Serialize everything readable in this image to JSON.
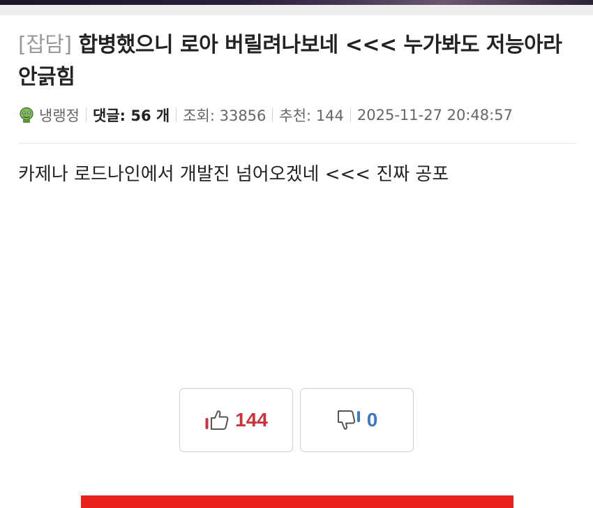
{
  "post": {
    "category": "[잡담]",
    "title": "합병했으니 로아 버릴려나보네 <<< 누가봐도 저능아라 안긁힘",
    "body": "카제나 로드나인에서 개발진 넘어오겠네 <<< 진짜 공포"
  },
  "meta": {
    "author": "냉랭정",
    "comments_label": "댓글:",
    "comments_count": "56 개",
    "views_label": "조회:",
    "views": "33856",
    "recommend_label": "추천:",
    "recommend": "144",
    "datetime": "2025-11-27 20:48:57"
  },
  "votes": {
    "up_count": "144",
    "down_count": "0"
  },
  "colors": {
    "upvote": "#c9353b",
    "downvote": "#3d78c4",
    "ad_banner": "#e8231e"
  },
  "icons": {
    "avatar": "zombie-avatar-icon",
    "upvote": "thumbs-up-icon",
    "downvote": "thumbs-down-icon"
  }
}
